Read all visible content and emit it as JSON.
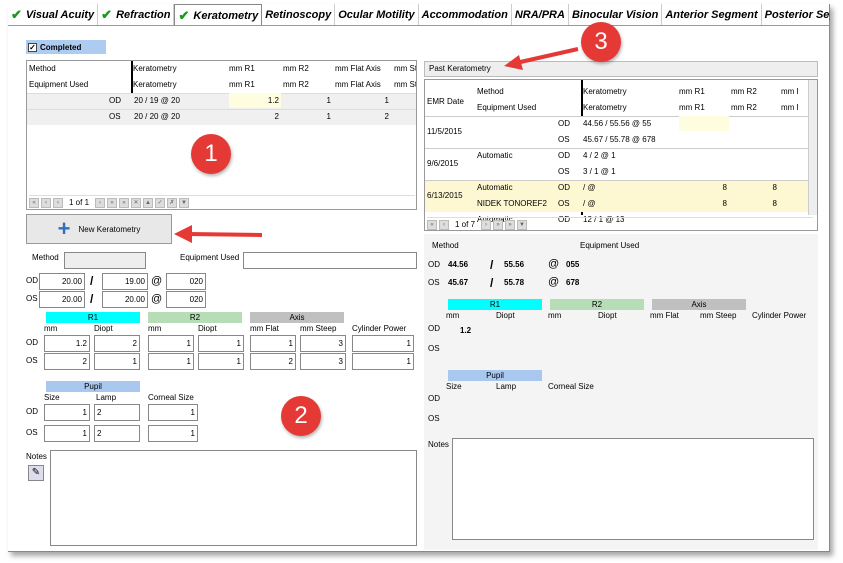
{
  "tabs": [
    {
      "label": "Visual Acuity",
      "check": true
    },
    {
      "label": "Refraction",
      "check": true
    },
    {
      "label": "Keratometry",
      "check": true,
      "active": true
    },
    {
      "label": "Retinoscopy"
    },
    {
      "label": "Ocular Motility"
    },
    {
      "label": "Accommodation"
    },
    {
      "label": "NRA/PRA"
    },
    {
      "label": "Binocular Vision"
    },
    {
      "label": "Anterior Segment"
    },
    {
      "label": "Posterior Segme"
    }
  ],
  "completed_label": "Completed",
  "grid1": {
    "h1": [
      "Method",
      "Keratometry",
      "mm R1",
      "mm R2",
      "mm Flat Axis",
      "mm St"
    ],
    "h2": [
      "Equipment Used",
      "Keratometry",
      "mm R1",
      "mm R2",
      "mm Flat Axis",
      "mm St"
    ],
    "rows": [
      {
        "eye": "OD",
        "k": "20 / 19 @ 20",
        "r1": "1.2",
        "r2": "1",
        "fa": "1"
      },
      {
        "eye": "OS",
        "k": "20 / 20 @ 20",
        "r1": "2",
        "r2": "1",
        "fa": "2"
      }
    ],
    "pager": "1 of 1"
  },
  "new_button": "New Keratometry",
  "form": {
    "method_label": "Method",
    "equip_label": "Equipment Used",
    "od": "OD",
    "os": "OS",
    "od_a": "20.00",
    "od_b": "19.00",
    "od_c": "020",
    "os_a": "20.00",
    "os_b": "20.00",
    "os_c": "020",
    "slash": "/",
    "at": "@",
    "r1": "R1",
    "r2": "R2",
    "axis": "Axis",
    "mm": "mm",
    "diopt": "Diopt",
    "mm_flat": "mm Flat",
    "mm_steep": "mm Steep",
    "cyl": "Cylinder Power",
    "od_vals": [
      "1.2",
      "2",
      "1",
      "1",
      "1",
      "3",
      "1"
    ],
    "os_vals": [
      "2",
      "1",
      "1",
      "1",
      "2",
      "3",
      "1"
    ],
    "pupil": "Pupil",
    "size": "Size",
    "lamp": "Lamp",
    "corneal": "Corneal Size",
    "pupil_od": [
      "1",
      "2",
      "1"
    ],
    "pupil_os": [
      "1",
      "2",
      "1"
    ],
    "notes": "Notes"
  },
  "past": {
    "title": "Past Keratometry",
    "h_date": "EMR Date",
    "h1": [
      "Method",
      "Keratometry",
      "mm R1",
      "mm R2",
      "mm I"
    ],
    "h2": [
      "Equipment Used",
      "Keratometry",
      "mm R1",
      "mm R2",
      "mm I"
    ],
    "rows": [
      {
        "date": "11/5/2015",
        "od_m": "",
        "os_m": "",
        "od_k": "44.56 / 55.56 @ 55",
        "os_k": "45.67 / 55.78 @ 678",
        "od_r1": "",
        "os_r1": "",
        "od_r2": "",
        "os_r2": ""
      },
      {
        "date": "9/6/2015",
        "od_m": "Automatic",
        "os_m": "",
        "od_k": "4 / 2 @ 1",
        "os_k": "3 / 1 @ 1",
        "od_r1": "",
        "os_r1": "",
        "od_r2": "",
        "os_r2": ""
      },
      {
        "date": "6/13/2015",
        "od_m": "Automatic",
        "os_m": "NIDEK TONOREF2",
        "od_k": " / @",
        "os_k": " / @",
        "od_r1": "8",
        "os_r1": "8",
        "od_r2": "8",
        "os_r2": "8"
      }
    ],
    "partial": {
      "m": "Automatic",
      "eye": "OD",
      "k": "12 / 1 @ 13"
    },
    "pager": "1 of 7",
    "method": "Method",
    "equip": "Equipment Used",
    "od": "OD",
    "os": "OS",
    "od_a": "44.56",
    "od_b": "55.56",
    "od_c": "055",
    "os_a": "45.67",
    "os_b": "55.78",
    "os_c": "678",
    "r1_val": "1.2",
    "notes": "Notes"
  },
  "callouts": [
    "1",
    "2",
    "3"
  ],
  "colors": {
    "r1": "#00ffff",
    "r2": "#b6ddb6",
    "axis": "#c0c0c0",
    "pupil": "#a9c8f0",
    "completed": "#aecbf0",
    "callout": "#e53935"
  }
}
